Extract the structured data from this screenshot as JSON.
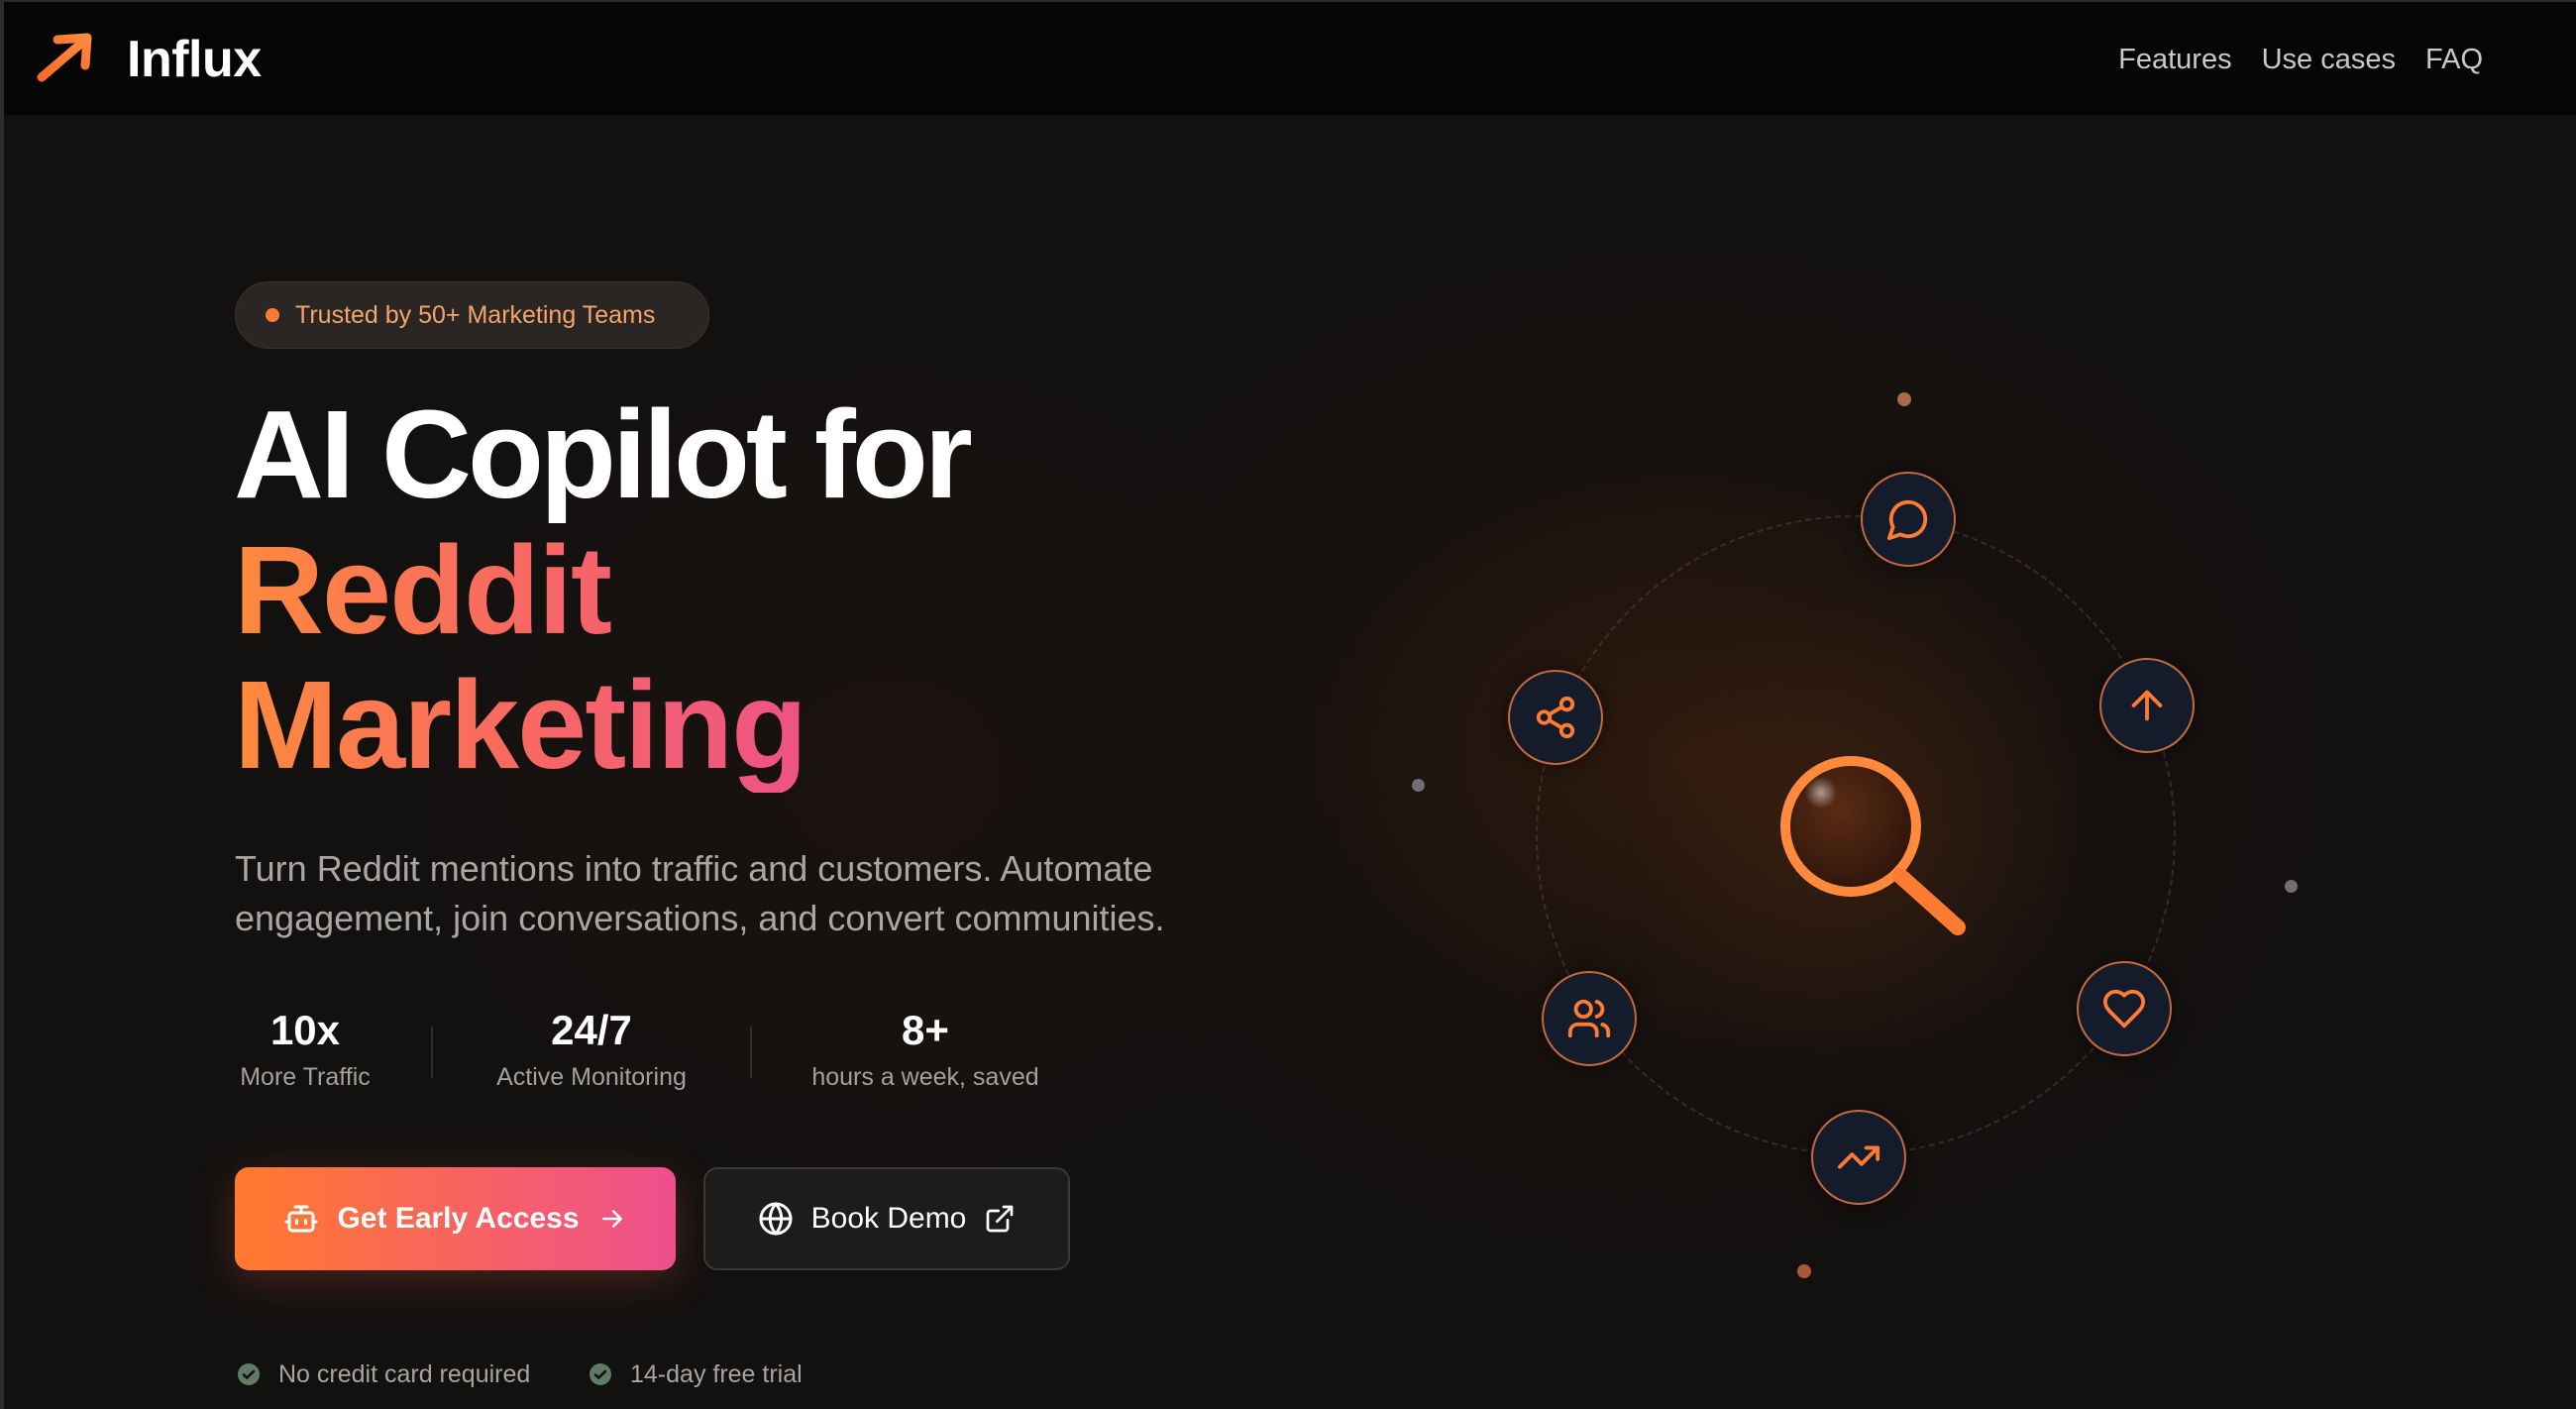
{
  "nav": {
    "logo_text": "Influx",
    "links": [
      {
        "label": "Features"
      },
      {
        "label": "Use cases"
      },
      {
        "label": "FAQ"
      }
    ]
  },
  "hero": {
    "badge": "Trusted by 50+ Marketing Teams",
    "title_line1": "AI Copilot for",
    "title_line2": "Reddit",
    "title_line3": "Marketing",
    "description": "Turn Reddit mentions into traffic and customers. Automate engagement, join conversations, and convert communities."
  },
  "stats": [
    {
      "value": "10x",
      "label": "More Traffic"
    },
    {
      "value": "24/7",
      "label": "Active Monitoring"
    },
    {
      "value": "8+",
      "label": "hours a week, saved"
    }
  ],
  "cta": {
    "primary_label": "Get Early Access",
    "secondary_label": "Book Demo"
  },
  "footnotes": [
    {
      "label": "No credit card required"
    },
    {
      "label": "14-day free trial"
    }
  ],
  "orbit": {
    "center_icon": "magnifier-icon",
    "nodes": [
      {
        "icon": "chat-bubble-icon"
      },
      {
        "icon": "arrow-up-icon"
      },
      {
        "icon": "heart-icon"
      },
      {
        "icon": "trending-up-icon"
      },
      {
        "icon": "users-icon"
      },
      {
        "icon": "share-icon"
      }
    ]
  },
  "colors": {
    "accent_orange": "#ff7a2e",
    "accent_pink": "#ee4f8f",
    "background": "#131110",
    "check_green": "#5f7a66"
  }
}
